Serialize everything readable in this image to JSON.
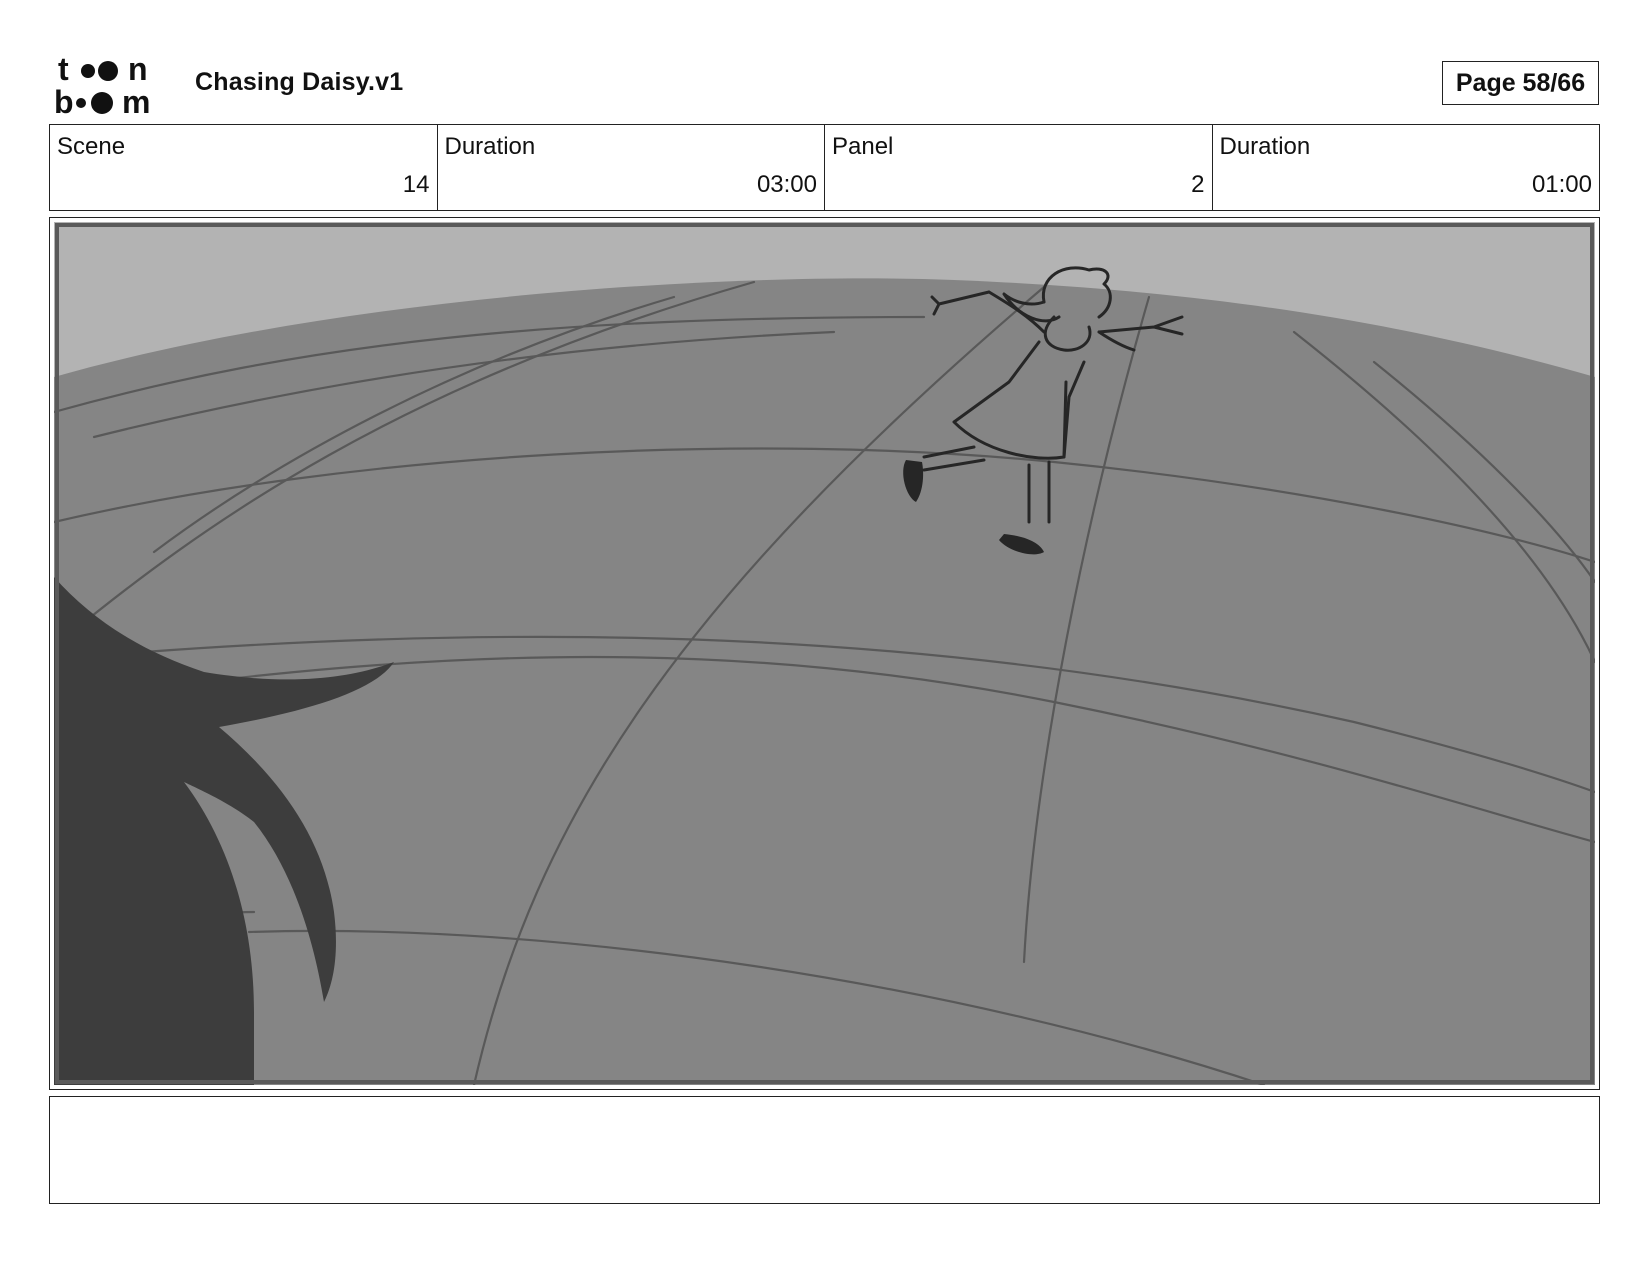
{
  "header": {
    "logo_text_top": "toon",
    "logo_text_bottom": "boom",
    "title": "Chasing Daisy.v1",
    "page_label": "Page 58/66"
  },
  "info": [
    {
      "label": "Scene",
      "value": "14"
    },
    {
      "label": "Duration",
      "value": "03:00"
    },
    {
      "label": "Panel",
      "value": "2"
    },
    {
      "label": "Duration",
      "value": "01:00"
    }
  ],
  "panel": {
    "sky_color": "#b3b3b3",
    "ground_color": "#858585",
    "line_color": "#555555",
    "foreground_shape_color": "#3d3d3d"
  },
  "notes": {
    "text": ""
  }
}
